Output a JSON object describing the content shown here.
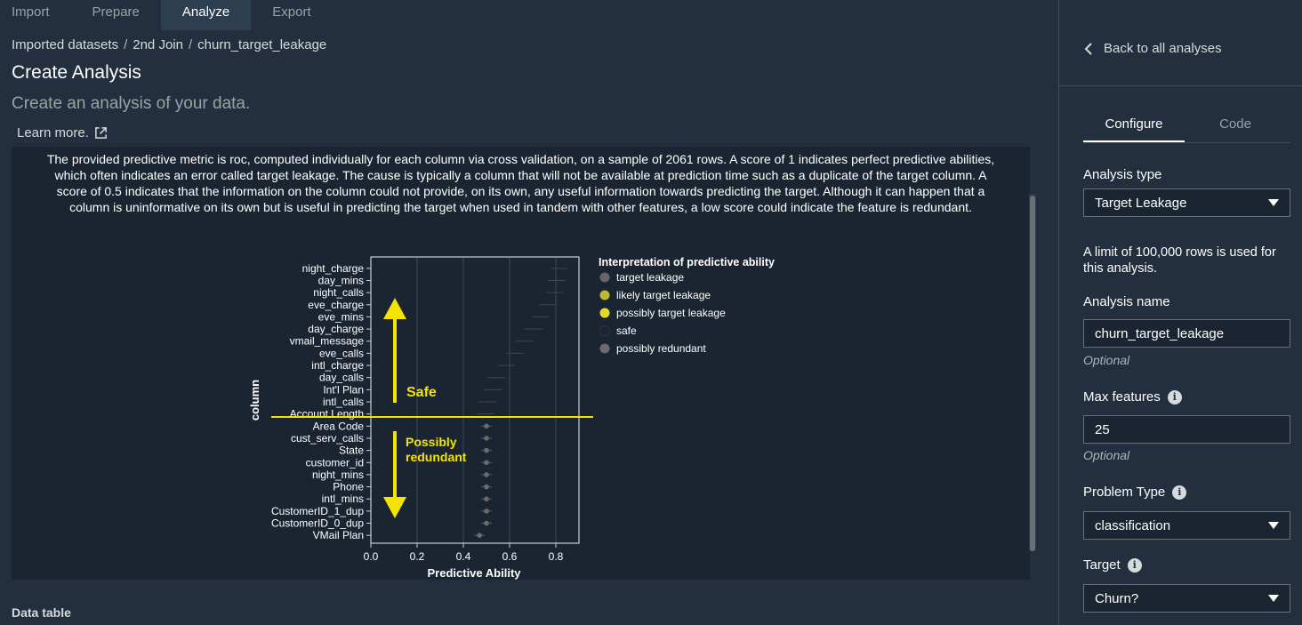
{
  "tabs": [
    "Import",
    "Prepare",
    "Analyze",
    "Export"
  ],
  "active_tab": "Analyze",
  "breadcrumb": [
    "Imported datasets",
    "2nd Join",
    "churn_target_leakage"
  ],
  "breadcrumb_sep": "/",
  "page_title": "Create Analysis",
  "subtitle": "Create an analysis of your data.",
  "learn_more": "Learn more.",
  "description": "The provided predictive metric is roc, computed individually for each column via cross validation, on a sample of 2061 rows. A score of 1 indicates perfect predictive abilities, which often indicates an error called target leakage. The cause is typically a column that will not be available at prediction time such as a duplicate of the target column. A score of 0.5 indicates that the information on the column could not provide, on its own, any useful information towards predicting the target. Although it can happen that a column is uninformative on its own but is useful in predicting the target when used in tandem with other features, a low score could indicate the feature is redundant.",
  "chart_data": {
    "type": "scatter",
    "xlabel": "Predictive Ability",
    "ylabel": "column",
    "xlim": [
      0.0,
      0.9
    ],
    "xticks": [
      0.0,
      0.2,
      0.4,
      0.6,
      0.8
    ],
    "grid": true,
    "legend_title": "Interpretation of predictive ability",
    "legend_placement": "right",
    "legend": [
      {
        "label": "target leakage",
        "color": "#666666"
      },
      {
        "label": "likely target leakage",
        "color": "#bfb72f"
      },
      {
        "label": "possibly target leakage",
        "color": "#e3da2a"
      },
      {
        "label": "safe",
        "color": "#1b2532"
      },
      {
        "label": "possibly redundant",
        "color": "#6b6b6b"
      }
    ],
    "categories": [
      "night_charge",
      "day_mins",
      "night_calls",
      "eve_charge",
      "eve_mins",
      "day_charge",
      "vmail_message",
      "eve_calls",
      "intl_charge",
      "day_calls",
      "Int'l Plan",
      "intl_calls",
      "Account Length",
      "Area Code",
      "cust_serv_calls",
      "State",
      "customer_id",
      "night_mins",
      "Phone",
      "intl_mins",
      "CustomerID_1_dup",
      "CustomerID_0_dup",
      "VMail Plan"
    ],
    "values": [
      0.83,
      0.82,
      0.81,
      0.78,
      0.75,
      0.72,
      0.68,
      0.64,
      0.6,
      0.56,
      0.54,
      0.52,
      0.51,
      0.5,
      0.5,
      0.5,
      0.5,
      0.5,
      0.5,
      0.5,
      0.5,
      0.5,
      0.47
    ],
    "interpretation": [
      "safe",
      "safe",
      "safe",
      "safe",
      "safe",
      "safe",
      "safe",
      "safe",
      "safe",
      "safe",
      "safe",
      "safe",
      "safe",
      "possibly redundant",
      "possibly redundant",
      "possibly redundant",
      "possibly redundant",
      "possibly redundant",
      "possibly redundant",
      "possibly redundant",
      "possibly redundant",
      "possibly redundant",
      "possibly redundant"
    ],
    "annotations": {
      "safe": "Safe",
      "redundant_line1": "Possibly",
      "redundant_line2": "redundant"
    },
    "annotation_color": "#f5e400"
  },
  "data_table_title": "Data table",
  "right": {
    "back_label": "Back to all analyses",
    "tabs": [
      "Configure",
      "Code"
    ],
    "active_tab": "Configure",
    "analysis_type_label": "Analysis type",
    "analysis_type_value": "Target Leakage",
    "limit_note": "A limit of 100,000 rows is used for this analysis.",
    "analysis_name_label": "Analysis name",
    "analysis_name_value": "churn_target_leakage",
    "optional": "Optional",
    "max_features_label": "Max features",
    "max_features_value": "25",
    "problem_type_label": "Problem Type",
    "problem_type_value": "classification",
    "target_label": "Target",
    "target_value": "Churn?",
    "help_glyph": "i"
  }
}
